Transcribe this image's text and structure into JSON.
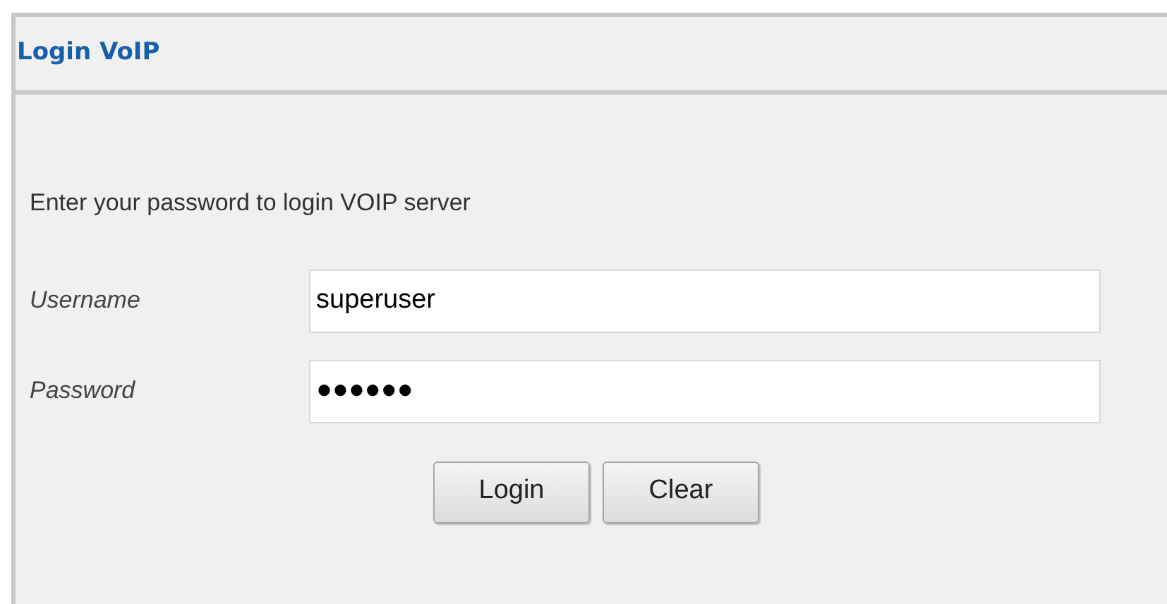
{
  "panel": {
    "title": "Login VoIP"
  },
  "intro": "Enter your password to login VOIP server",
  "fields": [
    {
      "label": "Username",
      "value": "superuser"
    },
    {
      "label": "Password",
      "value": "●●●●●●"
    }
  ],
  "buttons": [
    "Login",
    "Clear"
  ]
}
